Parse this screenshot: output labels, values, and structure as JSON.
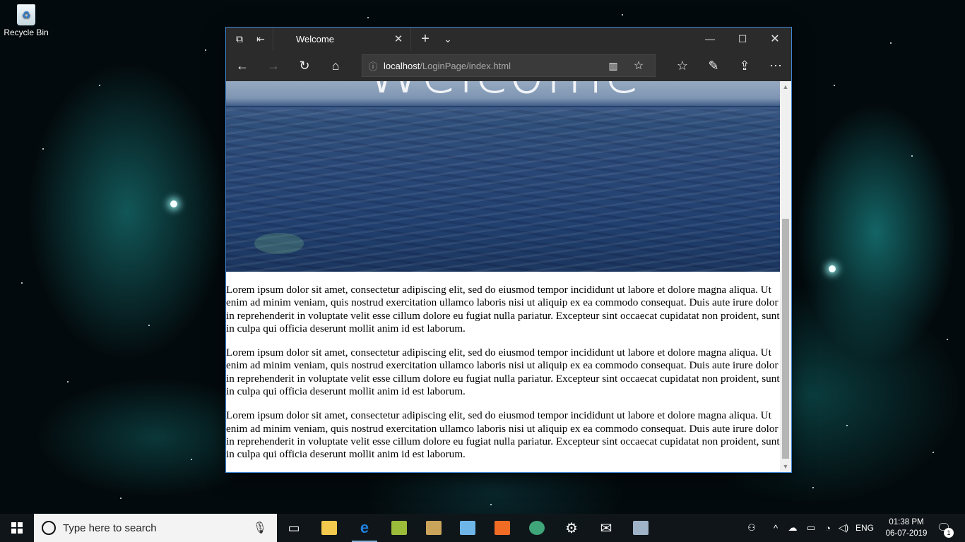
{
  "desktop": {
    "recycle_bin_label": "Recycle Bin"
  },
  "browser": {
    "tab_title": "Welcome",
    "address": {
      "host": "localhost",
      "path": "/LoginPage/index.html"
    },
    "page": {
      "hero_title": "Welcome",
      "paragraphs": [
        "Lorem ipsum dolor sit amet, consectetur adipiscing elit, sed do eiusmod tempor incididunt ut labore et dolore magna aliqua. Ut enim ad minim veniam, quis nostrud exercitation ullamco laboris nisi ut aliquip ex ea commodo consequat. Duis aute irure dolor in reprehenderit in voluptate velit esse cillum dolore eu fugiat nulla pariatur. Excepteur sint occaecat cupidatat non proident, sunt in culpa qui officia deserunt mollit anim id est laborum.",
        "Lorem ipsum dolor sit amet, consectetur adipiscing elit, sed do eiusmod tempor incididunt ut labore et dolore magna aliqua. Ut enim ad minim veniam, quis nostrud exercitation ullamco laboris nisi ut aliquip ex ea commodo consequat. Duis aute irure dolor in reprehenderit in voluptate velit esse cillum dolore eu fugiat nulla pariatur. Excepteur sint occaecat cupidatat non proident, sunt in culpa qui officia deserunt mollit anim id est laborum.",
        "Lorem ipsum dolor sit amet, consectetur adipiscing elit, sed do eiusmod tempor incididunt ut labore et dolore magna aliqua. Ut enim ad minim veniam, quis nostrud exercitation ullamco laboris nisi ut aliquip ex ea commodo consequat. Duis aute irure dolor in reprehenderit in voluptate velit esse cillum dolore eu fugiat nulla pariatur. Excepteur sint occaecat cupidatat non proident, sunt in culpa qui officia deserunt mollit anim id est laborum."
      ]
    }
  },
  "taskbar": {
    "search_placeholder": "Type here to search",
    "apps": [
      {
        "name": "task-view-icon"
      },
      {
        "name": "file-explorer-icon",
        "color": "#f2c94c"
      },
      {
        "name": "edge-icon",
        "color": "#1f7fe0"
      },
      {
        "name": "xampp-control-icon",
        "color": "#9bbb3b"
      },
      {
        "name": "package-icon",
        "color": "#c9a45a"
      },
      {
        "name": "notepad-icon",
        "color": "#6fb6e8"
      },
      {
        "name": "xampp-icon",
        "color": "#f06c25"
      },
      {
        "name": "atom-icon",
        "color": "#3fa67a"
      },
      {
        "name": "settings-icon"
      },
      {
        "name": "mail-icon"
      },
      {
        "name": "remote-desktop-icon",
        "color": "#9fb3c8"
      }
    ],
    "language": "ENG",
    "time": "01:38 PM",
    "date": "06-07-2019",
    "notification_count": "1"
  }
}
